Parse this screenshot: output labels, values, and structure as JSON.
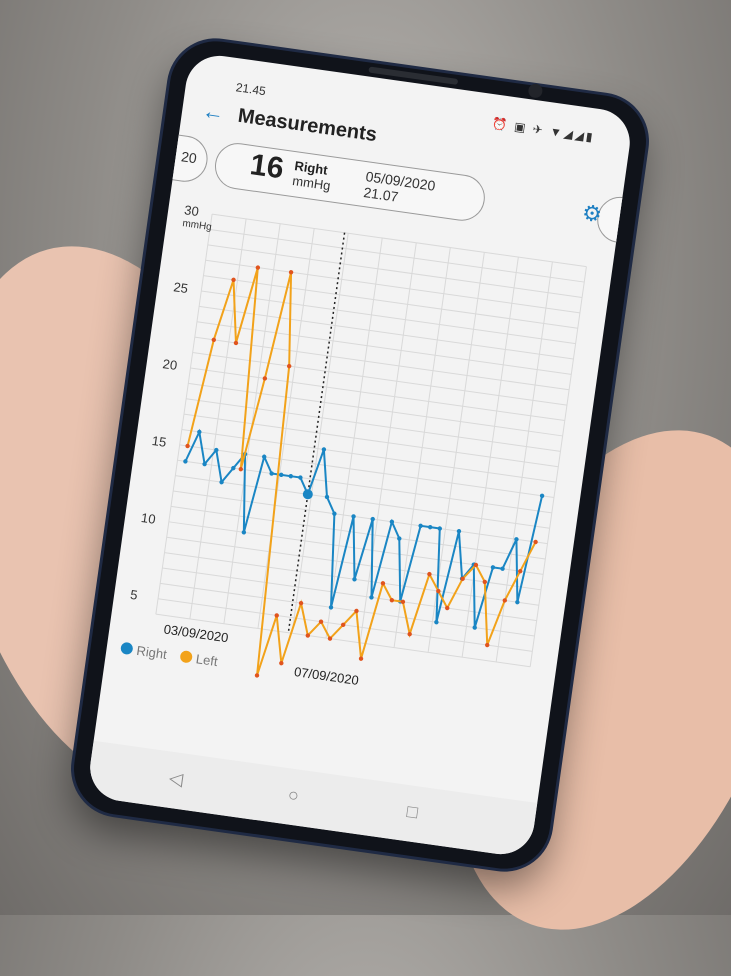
{
  "status_bar": {
    "time": "21.45",
    "icons": "⏰ ▣ ✈ ▼◢◢▮"
  },
  "header": {
    "title": "Measurements",
    "back_label": "←"
  },
  "selected_measurement": {
    "value": "16",
    "side": "Right",
    "unit": "mmHg",
    "date": "05/09/2020",
    "time": "21.07",
    "prev_pill_text": "20"
  },
  "colors": {
    "right": "#1a86c4",
    "left": "#f2a21a",
    "accent": "#1e7fc2"
  },
  "chart_data": {
    "type": "line",
    "y_unit": "mmHg",
    "ylim": [
      4,
      30
    ],
    "yticks": [
      "5",
      "10",
      "15",
      "20",
      "25",
      "30"
    ],
    "x_labels": [
      "03/09/2020",
      "07/09/2020"
    ],
    "legend": [
      "Right",
      "Left"
    ],
    "series": [
      {
        "name": "Right",
        "color": "#1a86c4",
        "values": [
          14,
          16,
          14,
          15,
          13,
          14,
          15,
          10,
          15,
          14,
          14,
          14,
          14,
          13,
          16,
          13,
          12,
          6,
          12,
          8,
          12,
          7,
          12,
          11,
          7,
          12,
          12,
          12,
          6,
          12,
          9,
          10,
          6,
          10,
          10,
          12,
          8,
          15
        ]
      },
      {
        "name": "Left",
        "color": "#f2a21a",
        "values": [
          15,
          22,
          26,
          22,
          27,
          14,
          20,
          27,
          21,
          1,
          5,
          2,
          6,
          4,
          5,
          4,
          5,
          6,
          3,
          8,
          7,
          7,
          5,
          9,
          8,
          7,
          9,
          10,
          9,
          5,
          8,
          10,
          12
        ]
      }
    ],
    "selected_index": 13
  },
  "nav": {
    "back": "◁",
    "home": "○",
    "recent": "□"
  }
}
